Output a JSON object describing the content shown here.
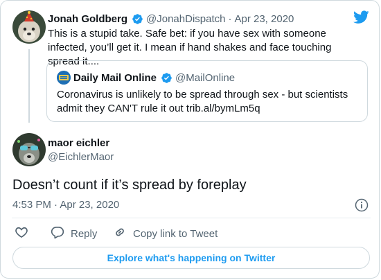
{
  "original_tweet": {
    "author_name": "Jonah Goldberg",
    "author_handle": "@JonahDispatch",
    "separator": "·",
    "date": "Apr 23, 2020",
    "text": "This is a stupid take. Safe bet: if you have sex with someone infected, you’ll get it. I mean if hand shakes and face touching spread it....",
    "quoted": {
      "author_name": "Daily Mail Online",
      "author_handle": "@MailOnline",
      "text": "Coronavirus is unlikely to be spread through sex - but scientists admit they CAN'T rule it out trib.al/bymLm5q"
    }
  },
  "reply_tweet": {
    "author_name": "maor eichler",
    "author_handle": "@EichlerMaor",
    "text": "Doesn’t count if it’s spread by foreplay",
    "time": "4:53 PM · Apr 23, 2020"
  },
  "actions": {
    "reply_label": "Reply",
    "copy_link_label": "Copy link to Tweet"
  },
  "explore_button_label": "Explore what's happening on Twitter",
  "colors": {
    "accent": "#1d9bf0",
    "muted_text": "#536471",
    "border": "#cfd9de"
  },
  "icons": [
    "twitter-bird-icon",
    "verified-badge-icon",
    "info-icon",
    "like-heart-icon",
    "reply-bubble-icon",
    "link-icon"
  ]
}
